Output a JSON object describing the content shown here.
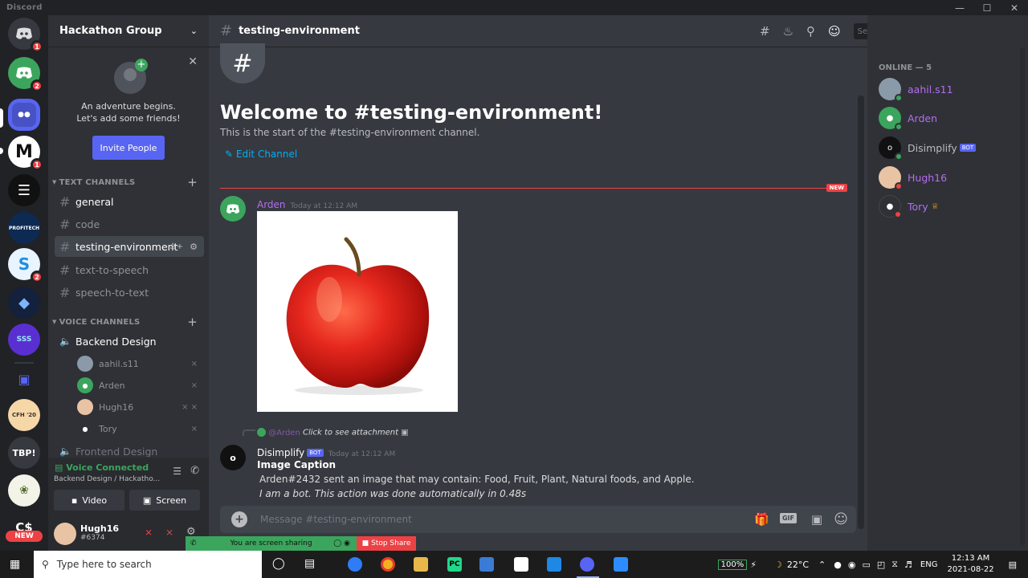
{
  "window": {
    "title": "Discord"
  },
  "guilds": {
    "badges": [
      "1",
      "2",
      "1",
      "2"
    ],
    "texts": {
      "tbp": "TBP!",
      "cs": "C$",
      "new": "NEW",
      "cfh": "CFH '20"
    }
  },
  "server": {
    "name": "Hackathon Group"
  },
  "invite": {
    "line1": "An adventure begins.",
    "line2": "Let's add some friends!",
    "button": "Invite People"
  },
  "categories": {
    "text": "TEXT CHANNELS",
    "voice": "VOICE CHANNELS"
  },
  "channels": [
    {
      "name": "general"
    },
    {
      "name": "code"
    },
    {
      "name": "testing-environment"
    },
    {
      "name": "text-to-speech"
    },
    {
      "name": "speech-to-text"
    }
  ],
  "voice": {
    "channel": "Backend Design",
    "users": [
      {
        "name": "aahil.s11"
      },
      {
        "name": "Arden"
      },
      {
        "name": "Hugh16"
      },
      {
        "name": "Tory"
      }
    ],
    "next_channel": "Frontend Design"
  },
  "voice_panel": {
    "status": "Voice Connected",
    "location": "Backend Design / Hackatho...",
    "video": "Video",
    "screen": "Screen"
  },
  "user_panel": {
    "name": "Hugh16",
    "tag": "#6374"
  },
  "header": {
    "channel": "testing-environment",
    "search_placeholder": "Search"
  },
  "welcome": {
    "title": "Welcome to #testing-environment!",
    "subtitle": "This is the start of the #testing-environment channel.",
    "edit": "Edit Channel",
    "new_badge": "NEW"
  },
  "messages": [
    {
      "author": "Arden",
      "time": "Today at 12:12 AM"
    },
    {
      "reply_to": "@Arden",
      "reply_text": "Click to see attachment",
      "author": "Disimplify",
      "bot_tag": "BOT",
      "time": "Today at 12:12 AM",
      "heading": "Image Caption",
      "line1": "Arden#2432 sent an image that may contain: Food, Fruit, Plant, Natural foods, and Apple.",
      "line2": "I am a bot. This action was done automatically in 0.48s"
    }
  ],
  "composer": {
    "placeholder": "Message #testing-environment",
    "gif": "GIF"
  },
  "members": {
    "header": "ONLINE — 5",
    "list": [
      {
        "name": "aahil.s11",
        "color": "#b46ef0"
      },
      {
        "name": "Arden",
        "color": "#b46ef0"
      },
      {
        "name": "Disimplify",
        "color": "#b9bbbe",
        "tag": "BOT"
      },
      {
        "name": "Hugh16",
        "color": "#b46ef0"
      },
      {
        "name": "Tory",
        "color": "#b46ef0"
      }
    ]
  },
  "screenshare": {
    "text": "You are screen sharing",
    "stop": "Stop Share"
  },
  "taskbar": {
    "search_placeholder": "Type here to search",
    "battery": "100%",
    "temp": "22°C",
    "lang": "ENG",
    "time": "12:13 AM",
    "date": "2021-08-22"
  },
  "colors": {
    "accent": "#5865f2",
    "danger": "#ed4245",
    "online": "#3ba55d",
    "link": "#00aff4"
  }
}
